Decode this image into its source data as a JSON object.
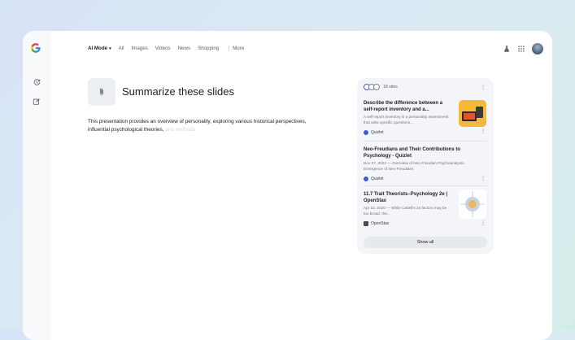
{
  "nav": {
    "tabs": [
      {
        "label": "AI Mode",
        "active": true,
        "has_menu": true
      },
      {
        "label": "All"
      },
      {
        "label": "Images"
      },
      {
        "label": "Videos"
      },
      {
        "label": "News"
      },
      {
        "label": "Shopping"
      }
    ],
    "more_label": "More"
  },
  "query": {
    "attachment_icon": "paperclip-icon",
    "title": "Summarize these slides"
  },
  "answer": {
    "text": "This presentation provides an overview of personality, exploring various historical perspectives, influential psychological theories,",
    "faded_tail": "and methods"
  },
  "sources": {
    "count_label": "18 sites",
    "items": [
      {
        "title": "Describe the difference between a self-report inventory and a...",
        "snippet": "A self-report inventory is a personality assessment that asks specific questions...",
        "source": "Quizlet"
      },
      {
        "title": "Neo-Freudians and Their Contributions to Psychology - Quizlet",
        "snippet": "Nov 27, 2024 — Overview of Neo-Freudian Psychoanalysis. Emergence of Neo-Freudians",
        "source": "Quizlet"
      },
      {
        "title": "11.7 Trait Theorists–Psychology 2e | OpenStax",
        "snippet": "Apr 22, 2020 — While Cattell's 16 factors may be too broad, the...",
        "source": "OpenStax"
      }
    ],
    "show_all_label": "Show all"
  },
  "colors": {
    "accent_blue": "#3e5bd4",
    "panel_bg": "#f3f5f8"
  }
}
